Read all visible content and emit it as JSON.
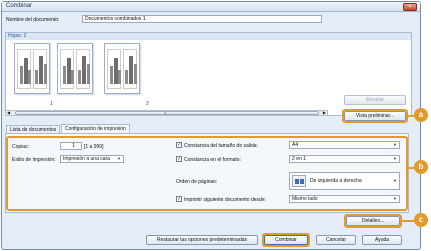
{
  "window": {
    "title": "Combinar",
    "close_glyph": "×"
  },
  "document_name": {
    "label": "Nombre del documento:",
    "value": "Documentos combinados 1"
  },
  "pages": {
    "header": "Hojas: 2",
    "thumbnails": [
      {
        "number": "1"
      },
      {
        "number": "2"
      }
    ],
    "scroll_glyph": "III"
  },
  "buttons": {
    "eliminar": "Eliminar",
    "vista_preliminar": "Vista preliminar...",
    "detalles": "Detalles...",
    "restaurar": "Restaurar las opciones predeterminadas",
    "combinar": "Combinar",
    "cancelar": "Cancelar",
    "ayuda": "Ayuda"
  },
  "tabs": [
    {
      "label": "Lista de documentos"
    },
    {
      "label": "Configuración de impresión"
    }
  ],
  "settings": {
    "copias_label": "Copias:",
    "copias_value": "1",
    "copias_range": "[1 a 999]",
    "estilo_label": "Estilo de impresión:",
    "estilo_value": "Impresión a una cara",
    "tamano_label": "Constancia del tamaño de salida:",
    "tamano_value": "A4",
    "formato_label": "Constancia en el formato:",
    "formato_value": "2 en 1",
    "orden_label": "Orden de páginas:",
    "orden_value": "De izquierda a derecha",
    "imprimir_label": "Imprimir siguiente documento desde:",
    "imprimir_value": "Mismo lado",
    "check_glyph": "✓",
    "arrow_glyph": "▼"
  },
  "callouts": {
    "a": "a",
    "b": "b",
    "c": "c"
  },
  "colors": {
    "accent": "#e39a2a",
    "link": "#1c4f9c"
  }
}
